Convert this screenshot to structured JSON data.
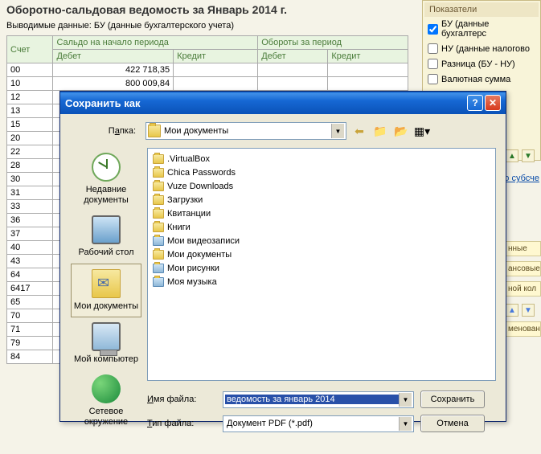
{
  "report": {
    "title": "Оборотно-сальдовая ведомость за Январь 2014 г.",
    "subtitle": "Выводимые данные:  БУ (данные бухгалтерского учета)",
    "col_account": "Счет",
    "col_start": "Сальдо на начало периода",
    "col_turnover": "Обороты за период",
    "col_debit": "Дебет",
    "col_credit": "Кредит",
    "rows": [
      {
        "acc": "00",
        "d": "422 718,35"
      },
      {
        "acc": "10",
        "d": "800 009,84"
      },
      {
        "acc": "12",
        "d": ""
      },
      {
        "acc": "13",
        "d": ""
      },
      {
        "acc": "15",
        "d": ""
      },
      {
        "acc": "20",
        "d": ""
      },
      {
        "acc": "22",
        "d": ""
      },
      {
        "acc": "28",
        "d": ""
      },
      {
        "acc": "30",
        "d": ""
      },
      {
        "acc": "31",
        "d": ""
      },
      {
        "acc": "33",
        "d": ""
      },
      {
        "acc": "36",
        "d": ""
      },
      {
        "acc": "37",
        "d": ""
      },
      {
        "acc": "40",
        "d": ""
      },
      {
        "acc": "43",
        "d": ""
      },
      {
        "acc": "64",
        "d": ""
      },
      {
        "acc": "6417",
        "d": ""
      },
      {
        "acc": "65",
        "d": ""
      },
      {
        "acc": "70",
        "d": ""
      },
      {
        "acc": "71",
        "d": ""
      },
      {
        "acc": "79",
        "d": ""
      },
      {
        "acc": "84",
        "d": ""
      }
    ]
  },
  "side": {
    "title": "Показатели",
    "opts": [
      {
        "label": "БУ (данные бухгалтерс",
        "checked": true
      },
      {
        "label": "НУ (данные налогово",
        "checked": false
      },
      {
        "label": "Разница (БУ - НУ)",
        "checked": false
      },
      {
        "label": "Валютная сумма",
        "checked": false
      }
    ],
    "sub_link": "о субсче",
    "frags": [
      "нные",
      "ансовые",
      "ной кол",
      "менован"
    ]
  },
  "dialog": {
    "title": "Сохранить как",
    "folder_label_pre": "П",
    "folder_label_u": "а",
    "folder_label_post": "пка:",
    "folder_value": "Мои документы",
    "places": [
      {
        "key": "recent",
        "label": "Недавние документы"
      },
      {
        "key": "desktop",
        "label": "Рабочий стол"
      },
      {
        "key": "mydocs",
        "label": "Мои документы"
      },
      {
        "key": "computer",
        "label": "Мой компьютер"
      },
      {
        "key": "network",
        "label": "Сетевое окружение"
      }
    ],
    "files": [
      {
        "name": ".VirtualBox",
        "special": false
      },
      {
        "name": "Chica Passwords",
        "special": false
      },
      {
        "name": "Vuze Downloads",
        "special": false
      },
      {
        "name": "Загрузки",
        "special": false
      },
      {
        "name": "Квитанции",
        "special": false
      },
      {
        "name": "Книги",
        "special": false
      },
      {
        "name": "Мои видеозаписи",
        "special": true
      },
      {
        "name": "Мои документы",
        "special": false
      },
      {
        "name": "Мои рисунки",
        "special": true
      },
      {
        "name": "Моя музыка",
        "special": true
      }
    ],
    "filename_label_pre": "",
    "filename_label_u": "И",
    "filename_label_post": "мя файла:",
    "filename_value": "ведомость за январь 2014",
    "filetype_label_pre": "",
    "filetype_label_u": "Т",
    "filetype_label_post": "ип файла:",
    "filetype_value": "Документ PDF (*.pdf)",
    "save_btn": "Сохранить",
    "cancel_btn": "Отмена"
  }
}
